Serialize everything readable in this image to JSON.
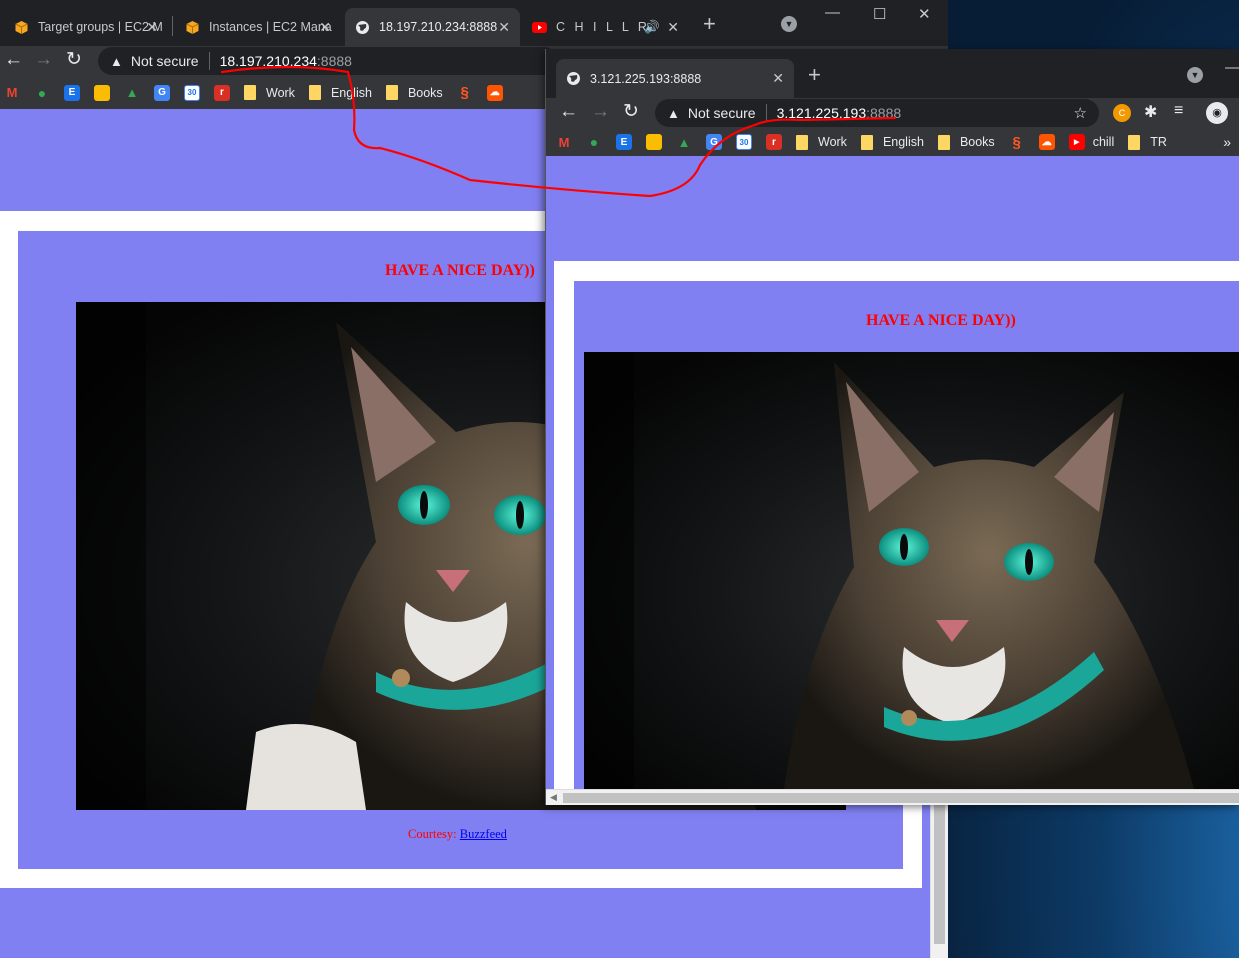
{
  "colors": {
    "page_bg": "#8080f2",
    "card_border": "#ffffff",
    "heading": "#ff0000",
    "link": "#0000ee",
    "annotation": "#ff0000"
  },
  "back_window": {
    "tabs": [
      {
        "label": "Target groups | EC2 M",
        "icon": "aws-box-icon"
      },
      {
        "label": "Instances | EC2 Mana",
        "icon": "aws-box-icon"
      },
      {
        "label": "18.197.210.234:8888",
        "icon": "globe-icon",
        "active": true
      },
      {
        "label": "C H I L L   R",
        "icon": "youtube-icon"
      }
    ],
    "address": {
      "security": "Not secure",
      "host": "18.197.210.234",
      "port": ":8888"
    },
    "bookmarks": [
      {
        "label": "",
        "icon": "gmail-icon"
      },
      {
        "label": "",
        "icon": "maps-icon"
      },
      {
        "label": "",
        "icon": "e-icon"
      },
      {
        "label": "",
        "icon": "keep-icon"
      },
      {
        "label": "",
        "icon": "drive-icon"
      },
      {
        "label": "",
        "icon": "translate-icon"
      },
      {
        "label": "",
        "icon": "calendar-icon"
      },
      {
        "label": "",
        "icon": "r-icon"
      },
      {
        "label": "Work",
        "icon": "folder-icon"
      },
      {
        "label": "English",
        "icon": "folder-icon"
      },
      {
        "label": "Books",
        "icon": "folder-icon"
      },
      {
        "label": "",
        "icon": "s-icon"
      },
      {
        "label": "",
        "icon": "soundcloud-icon"
      }
    ],
    "page": {
      "heading": "HAVE A NICE DAY))",
      "courtesy_prefix": "Courtesy: ",
      "courtesy_link": "Buzzfeed"
    }
  },
  "front_window": {
    "tabs": [
      {
        "label": "3.121.225.193:8888",
        "icon": "globe-icon",
        "active": true
      }
    ],
    "address": {
      "security": "Not secure",
      "host": "3.121.225.193",
      "port": ":8888"
    },
    "bookmarks": [
      {
        "label": "",
        "icon": "gmail-icon"
      },
      {
        "label": "",
        "icon": "maps-icon"
      },
      {
        "label": "",
        "icon": "e-icon"
      },
      {
        "label": "",
        "icon": "keep-icon"
      },
      {
        "label": "",
        "icon": "drive-icon"
      },
      {
        "label": "",
        "icon": "translate-icon"
      },
      {
        "label": "",
        "icon": "calendar-icon"
      },
      {
        "label": "",
        "icon": "r-icon"
      },
      {
        "label": "Work",
        "icon": "folder-icon"
      },
      {
        "label": "English",
        "icon": "folder-icon"
      },
      {
        "label": "Books",
        "icon": "folder-icon"
      },
      {
        "label": "",
        "icon": "s-icon"
      },
      {
        "label": "",
        "icon": "soundcloud-icon"
      },
      {
        "label": "chill",
        "icon": "youtube-icon"
      },
      {
        "label": "TR",
        "icon": "folder-icon"
      }
    ],
    "more_bookmarks": "»",
    "page": {
      "heading": "HAVE A NICE DAY))"
    }
  }
}
